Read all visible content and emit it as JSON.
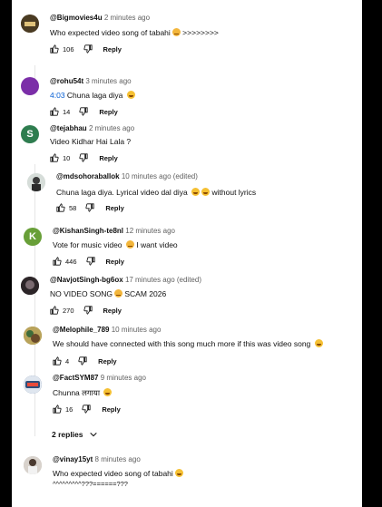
{
  "comments": [
    {
      "author": "@Bigmovies4u",
      "time": "2 minutes ago",
      "text": "Who expected video song of tabahi",
      "text_suffix": ">>>>>>>>",
      "likes": "106",
      "reply": "Reply",
      "avatar_color": "#5b4a2f"
    },
    {
      "author": "@rohu54t",
      "time": "3 minutes ago",
      "timestamp": "4:03",
      "text": "Chuna laga diya",
      "likes": "14",
      "reply": "Reply",
      "avatar_color": "#7b2ea8"
    },
    {
      "author": "@tejabhau",
      "time": "2 minutes ago",
      "avatar_letter": "S",
      "text": "Video Kidhar Hai Lala ?",
      "likes": "10",
      "reply": "Reply",
      "avatar_color": "#2e7d4f"
    },
    {
      "author": "@mdsohoraballok",
      "time": "10 minutes ago (edited)",
      "text": "Chuna laga diya. Lyrical video dal diya",
      "text_suffix": "without lyrics",
      "likes": "58",
      "reply": "Reply",
      "avatar_color": "#cfd8d3"
    },
    {
      "author": "@KishanSingh-te8nl",
      "time": "12 minutes ago",
      "avatar_letter": "K",
      "text": "Vote for music video",
      "text_suffix": "I want video",
      "likes": "446",
      "reply": "Reply",
      "avatar_color": "#689f38"
    },
    {
      "author": "@NavjotSingh-bg6ox",
      "time": "17 minutes ago (edited)",
      "text": "NO VIDEO SONG",
      "text_suffix": "SCAM 2026",
      "likes": "270",
      "reply": "Reply",
      "avatar_color": "#3a3236"
    },
    {
      "author": "@Melophile_789",
      "time": "10 minutes ago",
      "text": "We should have connected with this song much more if this was video song",
      "likes": "4",
      "reply": "Reply",
      "avatar_color": "#8a7a3a"
    },
    {
      "author": "@FactSYM87",
      "time": "9 minutes ago",
      "text": "Chunna लगाया",
      "likes": "16",
      "reply": "Reply",
      "avatar_color": "#2f4f7a"
    },
    {
      "author": "@vinay15yt",
      "time": "8 minutes ago",
      "text": "Who expected video song of tabahi",
      "text_line2": "^^^^^^^^^???======???",
      "avatar_color": "#c9c3bd"
    }
  ],
  "replies_toggle": "2 replies",
  "icons": {
    "like": "thumbs-up-icon",
    "dislike": "thumbs-down-icon",
    "expand": "chevron-down-icon"
  }
}
